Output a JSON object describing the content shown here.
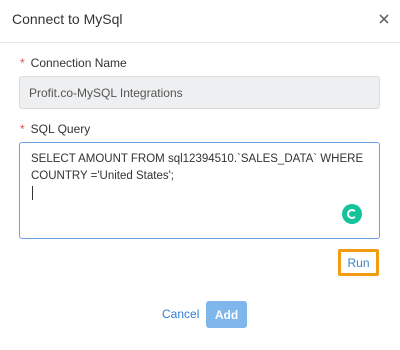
{
  "dialog": {
    "title": "Connect to MySql",
    "close_icon": "close-icon"
  },
  "connection_name": {
    "required_mark": "*",
    "label": "Connection Name",
    "value": "Profit.co-MySQL Integrations"
  },
  "sql_query": {
    "required_mark": "*",
    "label": "SQL Query",
    "value": "SELECT AMOUNT FROM sql12394510.`SALES_DATA` WHERE COUNTRY ='United States';",
    "badge_icon": "grammar-assistant-icon"
  },
  "actions": {
    "run_label": "Run",
    "cancel_label": "Cancel",
    "add_label": "Add"
  },
  "colors": {
    "run_highlight": "#f39c12",
    "add_button": "#7fb6ec",
    "link": "#2f80d1",
    "required": "#e55353",
    "badge": "#15c39a"
  }
}
